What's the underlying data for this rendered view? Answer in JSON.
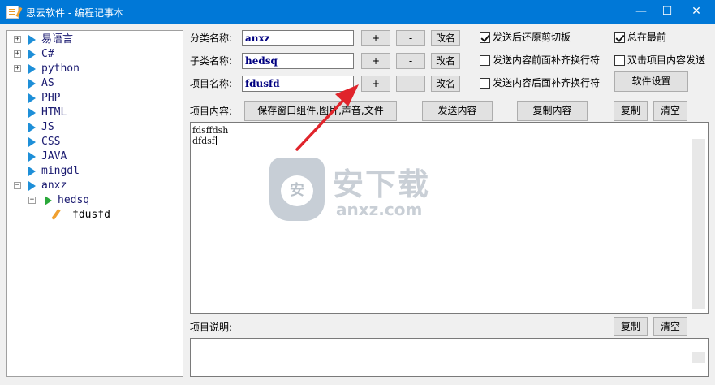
{
  "window": {
    "title": "思云软件 - 编程记事本",
    "icon": "notepad-icon",
    "controls": {
      "minimize": "—",
      "maximize": "☐",
      "close": "✕"
    }
  },
  "tree": {
    "items": [
      {
        "label": "易语言",
        "expander": "+"
      },
      {
        "label": "C#",
        "expander": "+"
      },
      {
        "label": "python",
        "expander": "+"
      },
      {
        "label": "AS"
      },
      {
        "label": "PHP"
      },
      {
        "label": "HTML"
      },
      {
        "label": "JS"
      },
      {
        "label": "CSS"
      },
      {
        "label": "JAVA"
      },
      {
        "label": "mingdl"
      },
      {
        "label": "anxz",
        "expander": "−"
      },
      {
        "label": "hedsq",
        "expander": "−"
      },
      {
        "label": "fdusfd"
      }
    ]
  },
  "form": {
    "category": {
      "label": "分类名称:",
      "value": "anxz"
    },
    "subcategory": {
      "label": "子类名称:",
      "value": "hedsq"
    },
    "item": {
      "label": "项目名称:",
      "value": "fdusfd"
    },
    "add_label": "+",
    "remove_label": "-",
    "rename_label": "改名"
  },
  "options": {
    "restore_clipboard": {
      "label": "发送后还原剪切板",
      "checked": true
    },
    "always_on_top": {
      "label": "总在最前",
      "checked": true
    },
    "pad_before": {
      "label": "发送内容前面补齐换行符",
      "checked": false
    },
    "double_click_send": {
      "label": "双击项目内容发送",
      "checked": false
    },
    "pad_after": {
      "label": "发送内容后面补齐换行符",
      "checked": false
    },
    "settings_label": "软件设置"
  },
  "content": {
    "label": "项目内容:",
    "save_label": "保存窗口组件,图片,声音,文件",
    "send_label": "发送内容",
    "copy_content_label": "复制内容",
    "copy_label": "复制",
    "clear_label": "清空",
    "lines": [
      "fdsffdsh",
      "dfdsf"
    ]
  },
  "note": {
    "label": "项目说明:",
    "copy_label": "复制",
    "clear_label": "清空"
  },
  "watermark": {
    "cn": "安下载",
    "en": "anxz.com",
    "logo_glyph": "安"
  },
  "colors": {
    "titlebar": "#0078d7",
    "tree_text": "#1a1a70",
    "field_text": "#000080",
    "arrow": "#e0242b"
  }
}
